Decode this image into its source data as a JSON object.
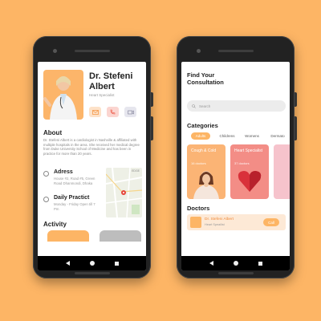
{
  "left_screen": {
    "doctor_name": "Dr. Stefeni Albert",
    "doctor_role": "Heart Specialist",
    "about_title": "About",
    "about_text": "Dr. Stefeni Albert is a cardiologist in Nashville & affiliated with multiple hospitals in the area. She received her medical degree from Duke University School of Medicine and has been in practice for more than 20 years.",
    "address_title": "Adress",
    "address_text": "House #2, Road #5, Green Road Dhanmondi, Dhaka",
    "daily_title": "Daily Practict",
    "daily_text": "Monday - Friday Open till 7 Pm",
    "activity_title": "Activity",
    "map_label": "EDGE",
    "action_icons": [
      "mail-icon",
      "phone-icon",
      "video-icon"
    ],
    "action_colors": [
      "#fde2c9",
      "#fbd5d0",
      "#e6e6ee"
    ]
  },
  "right_screen": {
    "title": "Find Your Consultation",
    "search_placeholder": "Search",
    "categories_title": "Categories",
    "chips": [
      "Adults",
      "Childrens",
      "Womens",
      "Dermato"
    ],
    "cards": [
      {
        "title": "Cough & Cold",
        "count": "16 doctors",
        "color": "#fbb475"
      },
      {
        "title": "Heart Specialist",
        "count": "37 doctors",
        "color": "#f38d86"
      },
      {
        "title": "",
        "count": "",
        "color": "#f6c3cc"
      }
    ],
    "doctors_title": "Doctors",
    "doctor_item": {
      "name": "Dr. Stefeni Albert",
      "role": "Heart Speailist",
      "button": "Call"
    }
  },
  "colors": {
    "accent": "#fdb565",
    "background": "#fdb565"
  }
}
